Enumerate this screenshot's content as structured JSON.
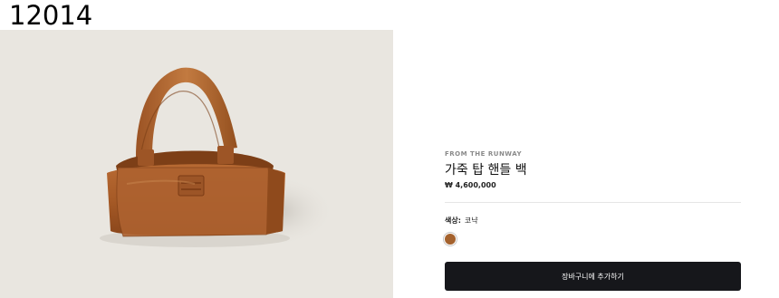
{
  "header": {
    "item_id": "12014"
  },
  "product": {
    "eyebrow": "FROM THE RUNWAY",
    "name": "가죽 탑 핸들 백",
    "price": "₩ 4,600,000",
    "color_label": "색상:",
    "color_value": "코냑",
    "swatch_color": "#a4622e",
    "image_logo_text": "miu miu"
  },
  "actions": {
    "add_to_cart": "장바구니에 추가하기"
  }
}
